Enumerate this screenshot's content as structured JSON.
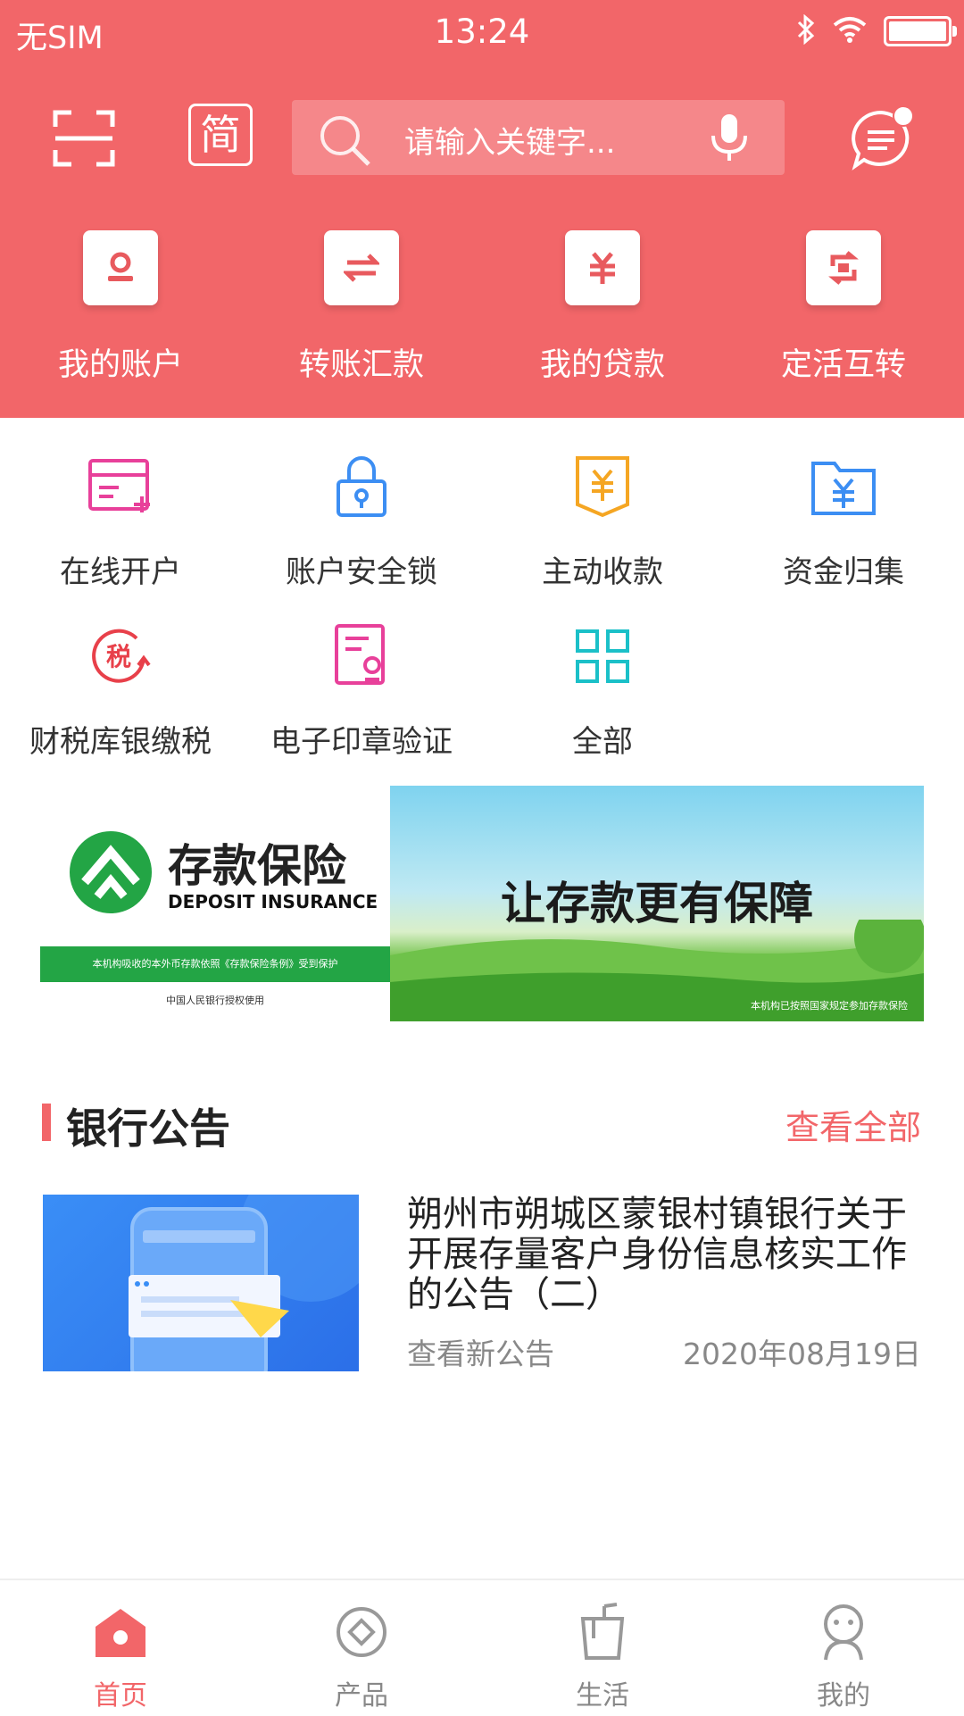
{
  "colors": {
    "brand": "#f26669",
    "white": "#ffffff",
    "deposit_green": "#23a545"
  },
  "status_bar": {
    "carrier": "无SIM",
    "time": "13:24"
  },
  "header": {
    "simplified_label": "简",
    "search_placeholder": "请输入关键字...",
    "quick_actions": [
      {
        "label": "我的账户",
        "icon": "account-icon"
      },
      {
        "label": "转账汇款",
        "icon": "transfer-icon"
      },
      {
        "label": "我的贷款",
        "icon": "loan-icon"
      },
      {
        "label": "定活互转",
        "icon": "exchange-icon"
      }
    ]
  },
  "services": [
    {
      "label": "在线开户",
      "icon": "online-account-icon",
      "color": "#e8409a"
    },
    {
      "label": "账户安全锁",
      "icon": "security-lock-icon",
      "color": "#3c8ef3"
    },
    {
      "label": "主动收款",
      "icon": "receive-payment-icon",
      "color": "#f5a623"
    },
    {
      "label": "资金归集",
      "icon": "fund-collection-icon",
      "color": "#3c8ef3"
    },
    {
      "label": "财税库银缴税",
      "icon": "tax-payment-icon",
      "color": "#e8404a"
    },
    {
      "label": "电子印章验证",
      "icon": "seal-verify-icon",
      "color": "#e8409a"
    },
    {
      "label": "全部",
      "icon": "all-services-icon",
      "color": "#1bc0c8"
    }
  ],
  "banner": {
    "title": "存款保险",
    "subtitle": "DEPOSIT INSURANCE",
    "strip_text": "本机构吸收的本外币存款依照《存款保险条例》受到保护",
    "authorized": "中国人民银行授权使用",
    "slogan": "让存款更有保障",
    "note": "本机构已按照国家规定参加存款保险"
  },
  "notices": {
    "title": "银行公告",
    "more_label": "查看全部",
    "items": [
      {
        "title": "朔州市朔城区蒙银村镇银行关于开展存量客户身份信息核实工作的公告（二）",
        "tag": "查看新公告",
        "date": "2020年08月19日"
      }
    ]
  },
  "tabbar": [
    {
      "label": "首页",
      "icon": "home-icon",
      "active": true
    },
    {
      "label": "产品",
      "icon": "product-icon",
      "active": false
    },
    {
      "label": "生活",
      "icon": "life-icon",
      "active": false
    },
    {
      "label": "我的",
      "icon": "profile-icon",
      "active": false
    }
  ]
}
